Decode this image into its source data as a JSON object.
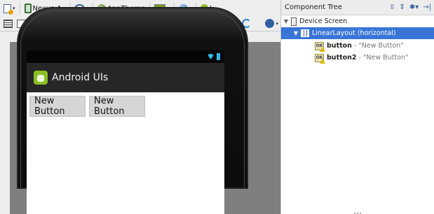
{
  "toolbar": {
    "device": "Nexus 4",
    "theme": "AppTheme",
    "api": "L"
  },
  "device_preview": {
    "app_title": "Android UIs",
    "buttons": [
      {
        "label": "New Button"
      },
      {
        "label": "New Button"
      }
    ]
  },
  "component_tree": {
    "title": "Component Tree",
    "nodes": [
      {
        "name": "Device Screen",
        "detail": "",
        "icon": "device-screen-icon"
      },
      {
        "name": "LinearLayout (horizontal)",
        "detail": "",
        "icon": "linear-layout-icon"
      },
      {
        "name": "button",
        "detail": "- \"New Button\"",
        "icon": "button-warning-icon"
      },
      {
        "name": "button2",
        "detail": "- \"New Button\"",
        "icon": "button-warning-icon"
      }
    ]
  },
  "colors": {
    "selection": "#3875d7",
    "action_bar": "#262626",
    "status_icons": "#33b5e5",
    "button_bg": "#d6d6d6",
    "canvas_bg": "#7f7f7f"
  }
}
